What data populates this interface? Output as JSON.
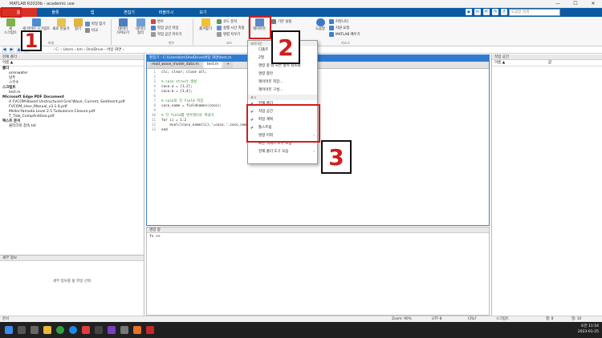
{
  "window": {
    "title": "MATLAB R2020b - academic use",
    "min": "—",
    "max": "☐",
    "close": "✕"
  },
  "tabs": [
    "홈",
    "플롯",
    "앱",
    "편집기",
    "퍼블리시",
    "보기"
  ],
  "search": {
    "placeholder": "도움말 검색"
  },
  "ribbon": {
    "new_script": "새\n스크립트",
    "new_live": "새 라이브 스크립트",
    "new": "새로 만들기",
    "open": "열기",
    "find_files": "파일 찾기",
    "compare": "비교",
    "import": "데이터\n가져오기",
    "clean": "데이터\n정리",
    "new_var": "변수",
    "save_ws": "작업 공간 저장",
    "clear_ws": "작업 공간 지우기",
    "favorites": "즐겨찾기",
    "analyze": "코드 분석",
    "run_time": "실행 시간 측정",
    "clear_cmd": "명령 지우기",
    "layout": "레이아웃",
    "prefs": "기본 설정",
    "help": "도움말",
    "community": "커뮤니티",
    "support": "지원 요청",
    "learn": "MATLAB 배우기",
    "grp_file": "파일",
    "grp_var": "변수",
    "grp_code": "코드",
    "grp_res": "리소스"
  },
  "address": {
    "path": "›  C:  ›  Users  ›  km  ›  OneDrive  ›  바탕 화면  ›"
  },
  "current_folder": {
    "header": "현재 폴더",
    "col_name": "이름 ▲",
    "items": [
      {
        "label": "폴더",
        "bold": true
      },
      {
        "label": "ocenwater"
      },
      {
        "label": "방주"
      },
      {
        "label": "스무수"
      },
      {
        "label": "스크립트",
        "bold": true
      },
      {
        "label": "test.m"
      },
      {
        "label": "Microsoft Edge PDF Document",
        "bold": true
      },
      {
        "label": "A FVCOM-Based Unstructured Grid Wave, Current, Sediment.pdf"
      },
      {
        "label": "FVCOM_User_Manual_v3.1.6.pdf"
      },
      {
        "label": "Mellor-Yamada Level 2.5 Turbulence Closure.pdf"
      },
      {
        "label": "T_Tide_CompAndGeo.pdf"
      },
      {
        "label": "텍스트 문서",
        "bold": true
      },
      {
        "label": "클라크의 참속.txt"
      }
    ]
  },
  "details": {
    "header": "세부 정보",
    "empty": "세부 정보를 볼 파일 선택"
  },
  "editor": {
    "header": "편집기 - C:\\Users\\km\\OneDrive\\바탕 화면\\test.m",
    "tabs": [
      "read_wave_model_data.m",
      "test.m",
      "+"
    ],
    "lines": [
      "clc; clear; close all;",
      "",
      "% coco struct 생성",
      "coco.a = [1,2];",
      "coco.b = [3,4];",
      "",
      "% coco의 각 field 저장",
      "coco_name = fieldnames(coco);",
      "",
      "% 각 field를 변수명으로 꺼내기",
      "for ii = 1:2",
      "    eval([coco_name{ii},'=coco.',coco_name{ii},';'])",
      "end"
    ],
    "line_numbers": [
      "1",
      "2",
      "3",
      "4",
      "5",
      "6",
      "7",
      "8",
      "9",
      "10",
      "11",
      "12",
      "13"
    ]
  },
  "command": {
    "header": "명령 창",
    "prompt": "fx >>"
  },
  "workspace": {
    "header": "작업 공간",
    "col_name": "이름 ▲",
    "col_value": "값"
  },
  "layout_menu": {
    "sec_select": "레이아웃",
    "items_top": [
      "디폴트",
      "2열",
      "명령 창 외 모든 항목 최소화",
      "명령 창만"
    ],
    "save": "레이아웃 저장...",
    "organize": "레이아웃 구성...",
    "sec_show": "표시",
    "checked": [
      "현재 폴더",
      "작업 공간",
      "파일 계획",
      "툴스트립"
    ],
    "more": [
      "명령 이력",
      "빠른 액세스 도구 모음",
      "현재 폴더 도구 모음"
    ]
  },
  "status": {
    "left": "준비",
    "zoom": "Zoom: 90%",
    "enc": "UTF-8",
    "eol": "CRLF",
    "type": "스크립트",
    "ln": "행: 8",
    "col": "열: 10"
  },
  "taskbar": {
    "time": "오전 11:54",
    "date": "2023-01-25"
  },
  "annotations": [
    "1",
    "2",
    "3"
  ]
}
